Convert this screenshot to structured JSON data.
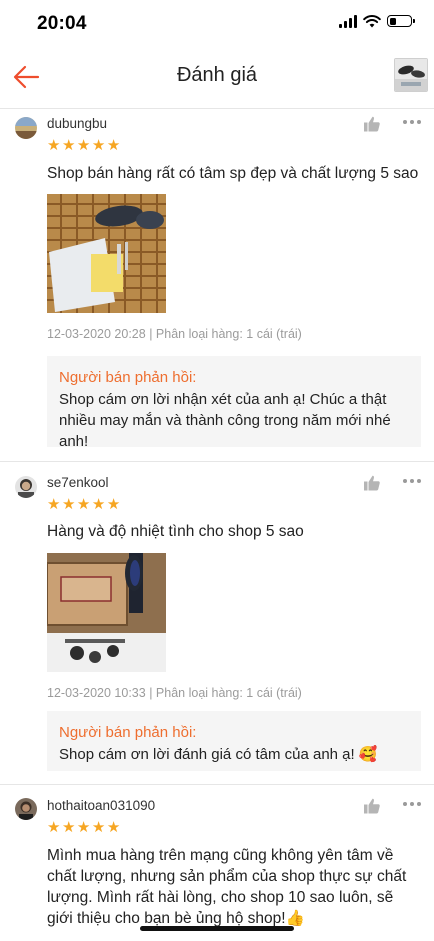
{
  "status_bar": {
    "time": "20:04",
    "signal_icon": "signal-icon",
    "wifi_icon": "wifi-icon",
    "battery_icon": "battery-icon",
    "battery_level": 0.3
  },
  "nav": {
    "title": "Đánh giá",
    "back_icon": "back-arrow-icon",
    "accent": "#ee4d2d"
  },
  "colors": {
    "star": "#f6a623",
    "reply_label": "#ee6e2f",
    "meta": "#9b9b9b",
    "reply_bg": "#f5f5f5"
  },
  "reviews": [
    {
      "username": "dubungbu",
      "rating": 5,
      "comment": "Shop bán hàng rất có tâm sp đẹp và chất lượng 5 sao",
      "date": "12-03-2020 20:28",
      "variant": "Phân loại hàng: 1 cái (trái)",
      "reply_label": "Người bán phản hồi:",
      "reply_text": "Shop cám ơn lời nhận xét của anh ạ! Chúc a thật nhiều may mắn và thành công trong năm mới nhé anh!"
    },
    {
      "username": "se7enkool",
      "rating": 5,
      "comment": "Hàng và độ nhiệt tình cho shop 5 sao",
      "date": "12-03-2020 10:33",
      "variant": "Phân loại hàng: 1 cái (trái)",
      "reply_label": "Người bán phản hồi:",
      "reply_text": "Shop cám ơn lời đánh giá có tâm của anh ạ! 🥰"
    },
    {
      "username": "hothaitoan031090",
      "rating": 5,
      "comment": "Mình mua hàng trên mạng cũng không yên tâm về chất lượng, nhưng sản phẩm của shop thực sự chất lượng. Mình rất hài lòng, cho shop 10 sao luôn, sẽ giới thiệu cho bạn bè ủng hộ shop!👍"
    }
  ],
  "separator": "|"
}
